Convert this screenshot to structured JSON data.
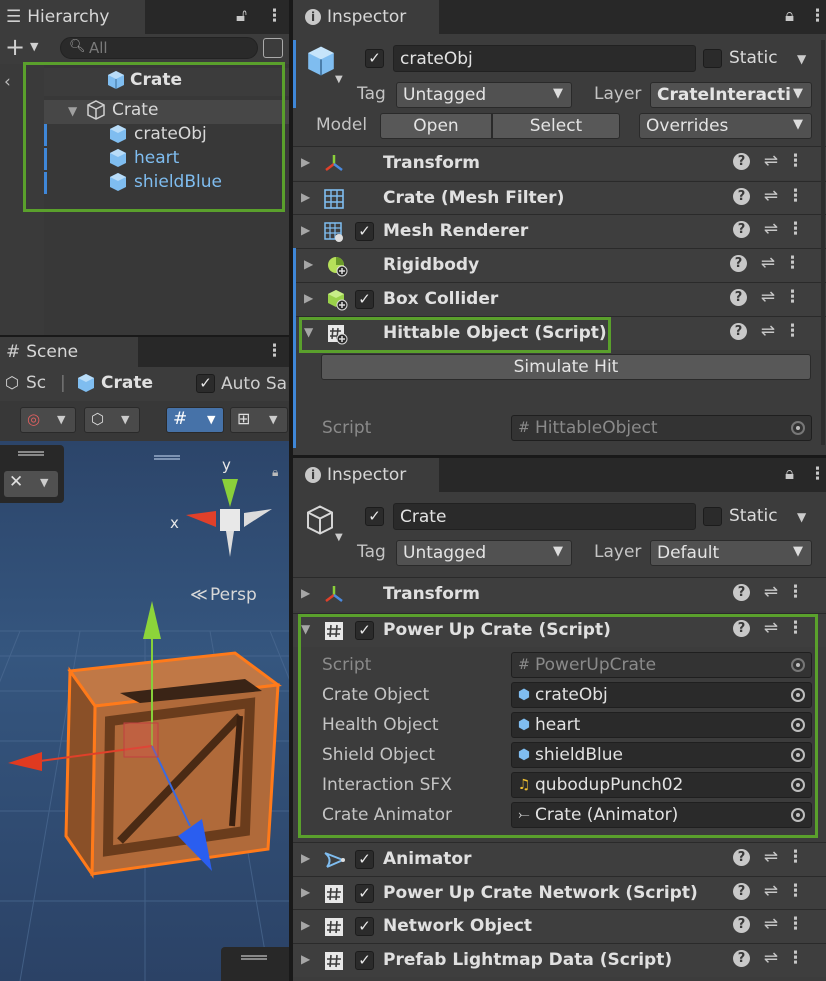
{
  "hierarchy": {
    "tab_label": "Hierarchy",
    "search_placeholder": "All",
    "items": [
      {
        "label": "Crate",
        "level": 0
      },
      {
        "label": "Crate",
        "level": 1
      },
      {
        "label": "crateObj",
        "level": 2
      },
      {
        "label": "heart",
        "level": 2
      },
      {
        "label": "shieldBlue",
        "level": 2
      }
    ]
  },
  "scene": {
    "tab_label": "Scene",
    "crumb_short": "Sc",
    "crumb_object": "Crate",
    "auto_save_label": "Auto Sa",
    "persp_label": "Persp",
    "axis_y": "y",
    "axis_x": "x"
  },
  "inspector_top": {
    "tab_label": "Inspector",
    "object_name": "crateObj",
    "static_label": "Static",
    "tag_label": "Tag",
    "tag_value": "Untagged",
    "layer_label": "Layer",
    "layer_value": "CrateInteracti",
    "model_label": "Model",
    "open_label": "Open",
    "select_label": "Select",
    "overrides_label": "Overrides",
    "components": [
      {
        "name": "Transform"
      },
      {
        "name": "Crate (Mesh Filter)"
      },
      {
        "name": "Mesh Renderer"
      },
      {
        "name": "Rigidbody"
      },
      {
        "name": "Box Collider"
      },
      {
        "name": "Hittable Object (Script)"
      }
    ],
    "simulate_hit_label": "Simulate Hit",
    "script_label": "Script",
    "script_value": "HittableObject"
  },
  "inspector_bottom": {
    "tab_label": "Inspector",
    "object_name": "Crate",
    "static_label": "Static",
    "tag_label": "Tag",
    "tag_value": "Untagged",
    "layer_label": "Layer",
    "layer_value": "Default",
    "components": [
      {
        "name": "Transform"
      },
      {
        "name": "Power Up Crate (Script)"
      },
      {
        "name": "Animator"
      },
      {
        "name": "Power Up Crate Network (Script)"
      },
      {
        "name": "Network Object"
      },
      {
        "name": "Prefab Lightmap Data (Script)"
      }
    ],
    "props": [
      {
        "label": "Script",
        "value": "PowerUpCrate"
      },
      {
        "label": "Crate Object",
        "value": "crateObj"
      },
      {
        "label": "Health Object",
        "value": "heart"
      },
      {
        "label": "Shield Object",
        "value": "shieldBlue"
      },
      {
        "label": "Interaction SFX",
        "value": "qubodupPunch02"
      },
      {
        "label": "Crate Animator",
        "value": "Crate (Animator)"
      }
    ]
  },
  "colors": {
    "highlight": "#5aa02c",
    "selection_blue": "#3f87d8",
    "prefab_blue": "#7fbdf0",
    "crate_orange": "#ff7a1a"
  }
}
